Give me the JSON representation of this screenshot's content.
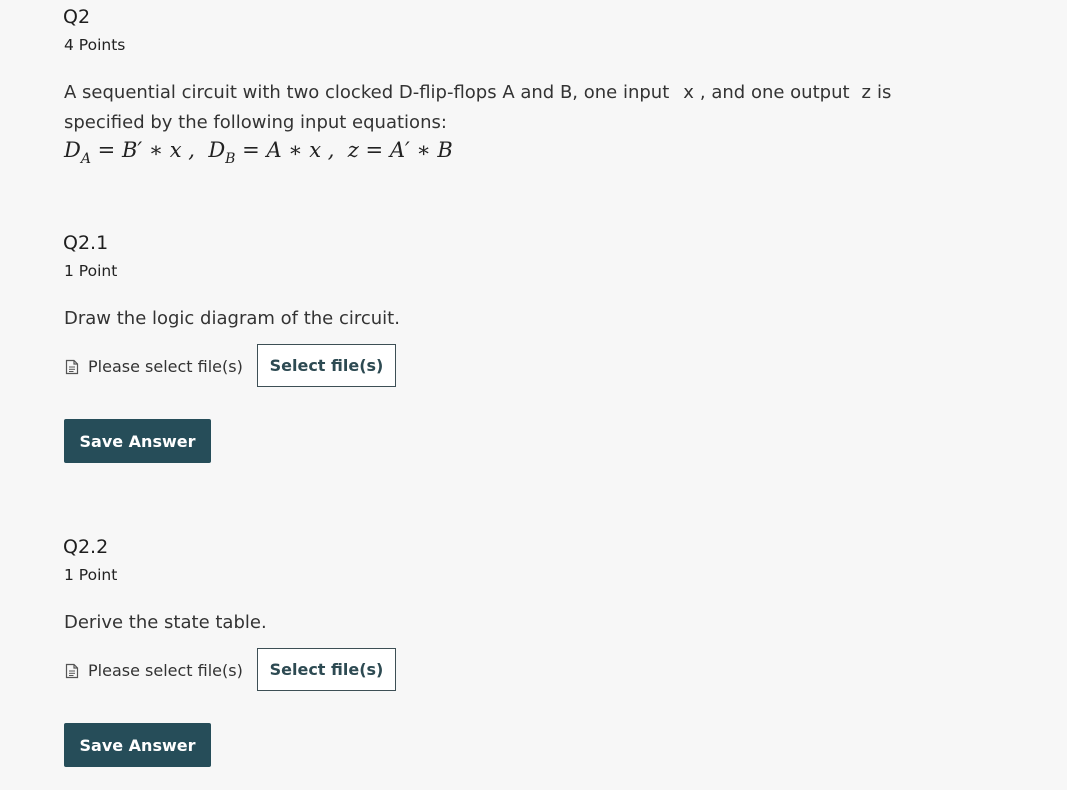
{
  "question": {
    "title": "Q2",
    "points": "4 Points",
    "prompt_line1_a": "A sequential circuit with two clocked D-flip-flops A and B, one input",
    "prompt_var_x": "x",
    "prompt_line1_b": ", and one output",
    "prompt_var_z": "z",
    "prompt_line1_c": "is",
    "prompt_line2": "specified by the following input equations:"
  },
  "subquestions": [
    {
      "title": "Q2.1",
      "points": "1 Point",
      "prompt": "Draw the logic diagram of the circuit.",
      "file_label": "Please select file(s)",
      "select_button": "Select file(s)",
      "save_button": "Save Answer"
    },
    {
      "title": "Q2.2",
      "points": "1 Point",
      "prompt": "Derive the state table.",
      "file_label": "Please select file(s)",
      "select_button": "Select file(s)",
      "save_button": "Save Answer"
    }
  ],
  "icons": {
    "file": "file-icon"
  },
  "colors": {
    "background": "#f7f7f7",
    "save_button_bg": "#264d59",
    "select_button_border": "#3d4f55"
  }
}
